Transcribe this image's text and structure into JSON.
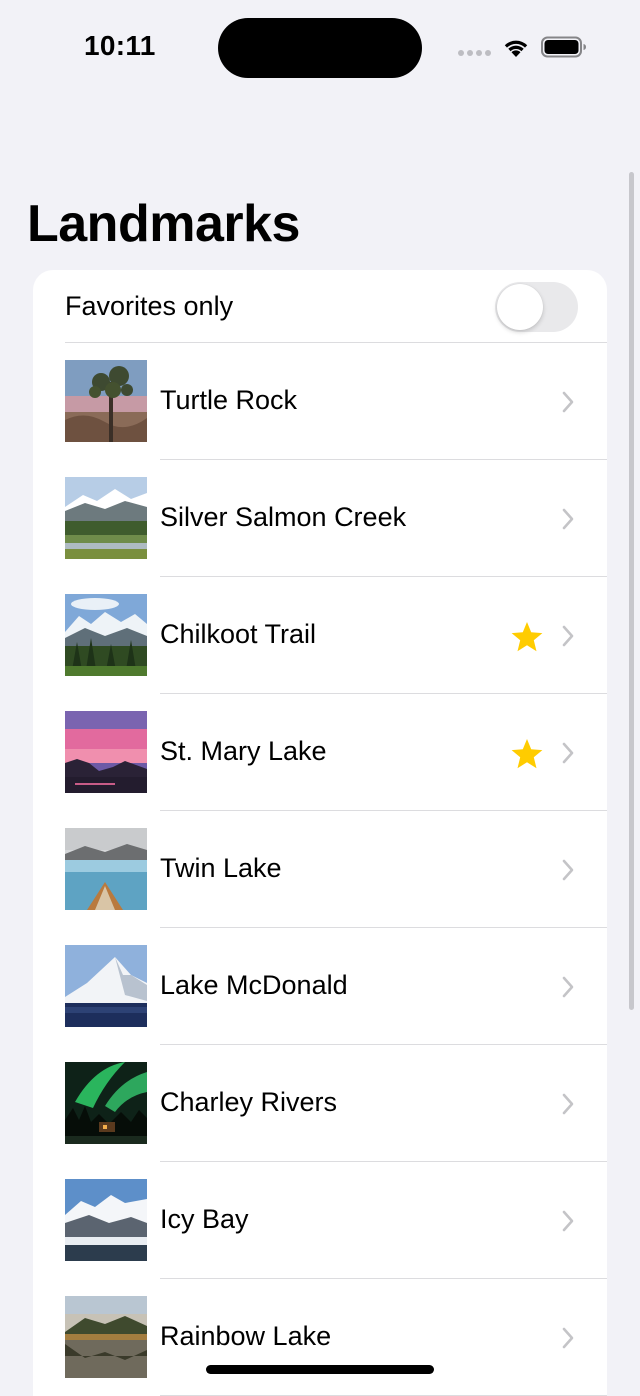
{
  "status_bar": {
    "time": "10:11"
  },
  "header": {
    "title": "Landmarks"
  },
  "filter": {
    "label": "Favorites only",
    "favorites_only": false
  },
  "landmarks": [
    {
      "name": "Turtle Rock",
      "favorite": false,
      "thumbnail": "desert-joshua-tree"
    },
    {
      "name": "Silver Salmon Creek",
      "favorite": false,
      "thumbnail": "mountain-meadow"
    },
    {
      "name": "Chilkoot Trail",
      "favorite": true,
      "thumbnail": "forest-mountains"
    },
    {
      "name": "St. Mary Lake",
      "favorite": true,
      "thumbnail": "pink-sunset-lake"
    },
    {
      "name": "Twin Lake",
      "favorite": false,
      "thumbnail": "canoe-lake"
    },
    {
      "name": "Lake McDonald",
      "favorite": false,
      "thumbnail": "snowy-peak"
    },
    {
      "name": "Charley Rivers",
      "favorite": false,
      "thumbnail": "aurora-cabin"
    },
    {
      "name": "Icy Bay",
      "favorite": false,
      "thumbnail": "glacier-bay"
    },
    {
      "name": "Rainbow Lake",
      "favorite": false,
      "thumbnail": "reflection-lake"
    }
  ],
  "colors": {
    "background": "#f2f2f7",
    "star": "#ffcc00",
    "chevron": "#c4c4c7",
    "toggle_off": "#e9e9eb"
  }
}
